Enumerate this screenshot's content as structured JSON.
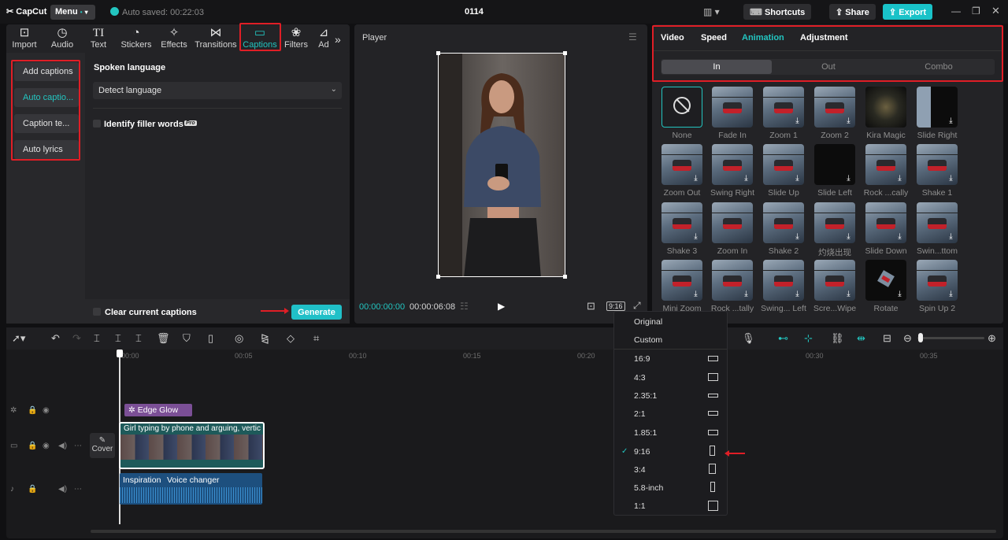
{
  "app": {
    "brand": "CapCut",
    "menu_label": "Menu",
    "autosave": "Auto saved: 00:22:03",
    "project_name": "0114",
    "shortcuts_label": "Shortcuts",
    "share_label": "Share",
    "export_label": "Export"
  },
  "media_tabs": [
    {
      "label": "Import",
      "icon": "import-icon"
    },
    {
      "label": "Audio",
      "icon": "audio-icon"
    },
    {
      "label": "Text",
      "icon": "text-icon"
    },
    {
      "label": "Stickers",
      "icon": "sticker-icon"
    },
    {
      "label": "Effects",
      "icon": "effects-icon"
    },
    {
      "label": "Transitions",
      "icon": "transitions-icon"
    },
    {
      "label": "Captions",
      "icon": "captions-icon",
      "active": true
    },
    {
      "label": "Filters",
      "icon": "filters-icon"
    },
    {
      "label": "Ad",
      "icon": "adjust-icon"
    }
  ],
  "captions_sidebar": [
    "Add captions",
    "Auto captio...",
    "Caption te...",
    "Auto lyrics"
  ],
  "captions_panel": {
    "language_heading": "Spoken language",
    "language_value": "Detect language",
    "filler_words_label": "Identify filler words",
    "pro_badge": "Pro",
    "clear_label": "Clear current captions",
    "generate_label": "Generate"
  },
  "player": {
    "title": "Player",
    "current_time": "00:00:00:00",
    "total_time": "00:00:06:08",
    "ratio_label": "9:16"
  },
  "inspector": {
    "tabs": [
      "Video",
      "Speed",
      "Animation",
      "Adjustment"
    ],
    "active_tab": "Animation",
    "subtabs": [
      "In",
      "Out",
      "Combo"
    ],
    "active_subtab": "In",
    "animations": [
      "None",
      "Fade In",
      "Zoom 1",
      "Zoom 2",
      "Kira Magic",
      "Slide Right",
      "Zoom Out",
      "Swing Right",
      "Slide Up",
      "Slide Left",
      "Rock ...cally",
      "Shake 1",
      "Shake 3",
      "Zoom In",
      "Shake 2",
      "灼烧出现",
      "Slide Down",
      "Swin...ttom",
      "Mini Zoom",
      "Rock ...tally",
      "Swing... Left",
      "Scre...Wipe",
      "Rotate",
      "Spin Up 2"
    ]
  },
  "ratio_menu": {
    "items": [
      "Original",
      "Custom",
      "16:9",
      "4:3",
      "2.35:1",
      "2:1",
      "1.85:1",
      "9:16",
      "3:4",
      "5.8-inch",
      "1:1"
    ],
    "selected": "9:16"
  },
  "timeline": {
    "ruler": [
      "00:00",
      "00:05",
      "00:10",
      "00:15",
      "00:20",
      "00:30",
      "00:35"
    ],
    "effect_clip": "Edge Glow",
    "video_clip": "Girl typing by phone and arguing, vertic",
    "cover_label": "Cover",
    "audio_labels": [
      "Inspiration",
      "Voice changer"
    ]
  },
  "colors": {
    "accent": "#23c5c0",
    "highlight_box": "#e01e26",
    "effect_clip": "#7b4f96",
    "audio_clip": "#1d4f7e",
    "video_clip_border": "#ffffff"
  }
}
